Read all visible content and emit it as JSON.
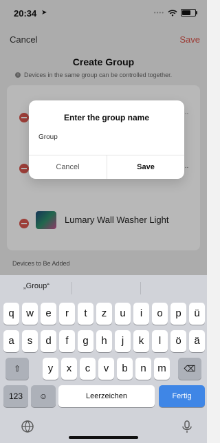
{
  "status": {
    "time": "20:34",
    "location_icon": "location-arrow-icon"
  },
  "nav": {
    "cancel": "Cancel",
    "save": "Save"
  },
  "page": {
    "title": "Create Group",
    "hint": "Devices in the same group can be controlled together.",
    "truncated_1": "...",
    "truncated_2": "...",
    "device_name": "Lumary Wall Washer Light",
    "section_label": "Devices to Be Added"
  },
  "dialog": {
    "title": "Enter the group name",
    "input_value": "Group",
    "cancel": "Cancel",
    "save": "Save"
  },
  "keyboard": {
    "suggestion": "„Group“",
    "row1": [
      "q",
      "w",
      "e",
      "r",
      "t",
      "z",
      "u",
      "i",
      "o",
      "p",
      "ü"
    ],
    "row2": [
      "a",
      "s",
      "d",
      "f",
      "g",
      "h",
      "j",
      "k",
      "l",
      "ö",
      "ä"
    ],
    "row3": [
      "y",
      "x",
      "c",
      "v",
      "b",
      "n",
      "m"
    ],
    "shift": "⇧",
    "backspace": "⌫",
    "numbers": "123",
    "emoji": "☺",
    "space": "Leerzeichen",
    "go": "Fertig"
  },
  "colors": {
    "accent": "#d9574e",
    "keyboard_blue": "#3f86e6"
  }
}
